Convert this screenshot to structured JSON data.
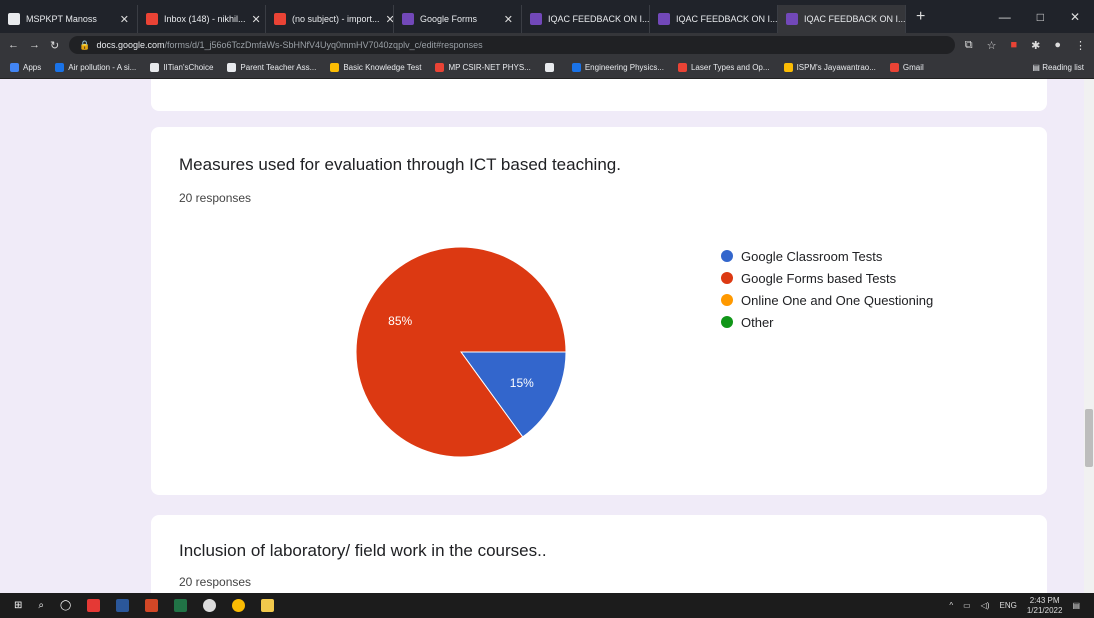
{
  "browser": {
    "tabs": [
      {
        "label": "MSPKPT Manoss",
        "color": "#e8eaed"
      },
      {
        "label": "Inbox (148) - nikhil...",
        "color": "#ea4335"
      },
      {
        "label": "(no subject) - import...",
        "color": "#ea4335"
      },
      {
        "label": "Google Forms",
        "color": "#7248b9"
      },
      {
        "label": "IQAC FEEDBACK ON I...",
        "color": "#7248b9"
      },
      {
        "label": "IQAC FEEDBACK ON I...",
        "color": "#7248b9"
      },
      {
        "label": "IQAC FEEDBACK ON I...",
        "color": "#7248b9"
      }
    ],
    "url_host": "docs.google.com",
    "url_path": "/forms/d/1_j56o6TczDmfaWs-SbHNfV4Uyq0mmHV7040zqplv_c/edit#responses",
    "bookmarks": [
      {
        "label": "Apps",
        "color": "#4285f4"
      },
      {
        "label": "Air pollution - A si...",
        "color": "#1a73e8"
      },
      {
        "label": "IITian'sChoice",
        "color": "#e8eaed"
      },
      {
        "label": "Parent Teacher Ass...",
        "color": "#e8eaed"
      },
      {
        "label": "Basic Knowledge Test",
        "color": "#fbbc04"
      },
      {
        "label": "MP CSIR-NET PHYS...",
        "color": "#ea4335"
      },
      {
        "label": "",
        "color": "#e8eaed"
      },
      {
        "label": "Engineering Physics...",
        "color": "#1a73e8"
      },
      {
        "label": "Laser Types and Op...",
        "color": "#ea4335"
      },
      {
        "label": "ISPM's Jayawantrao...",
        "color": "#fbbc04"
      },
      {
        "label": "Gmail",
        "color": "#ea4335"
      }
    ],
    "reading_list": "Reading list"
  },
  "question1": {
    "title": "Measures used for evaluation through ICT based teaching.",
    "responses": "20 responses"
  },
  "question2": {
    "title": "Inclusion of laboratory/ field work in the courses..",
    "responses": "20 responses"
  },
  "chart_data": {
    "type": "pie",
    "legend_position": "right",
    "labels": [
      "Google Classroom Tests",
      "Google Forms based Tests",
      "Online One and One Questioning",
      "Other"
    ],
    "values": [
      15,
      85,
      0,
      0
    ],
    "value_labels": [
      "15%",
      "85%",
      "",
      ""
    ],
    "colors": [
      "#3366cc",
      "#dc3912",
      "#ff9900",
      "#109618"
    ]
  },
  "taskbar": {
    "lang": "ENG",
    "time": "2:43 PM",
    "date": "1/21/2022"
  }
}
